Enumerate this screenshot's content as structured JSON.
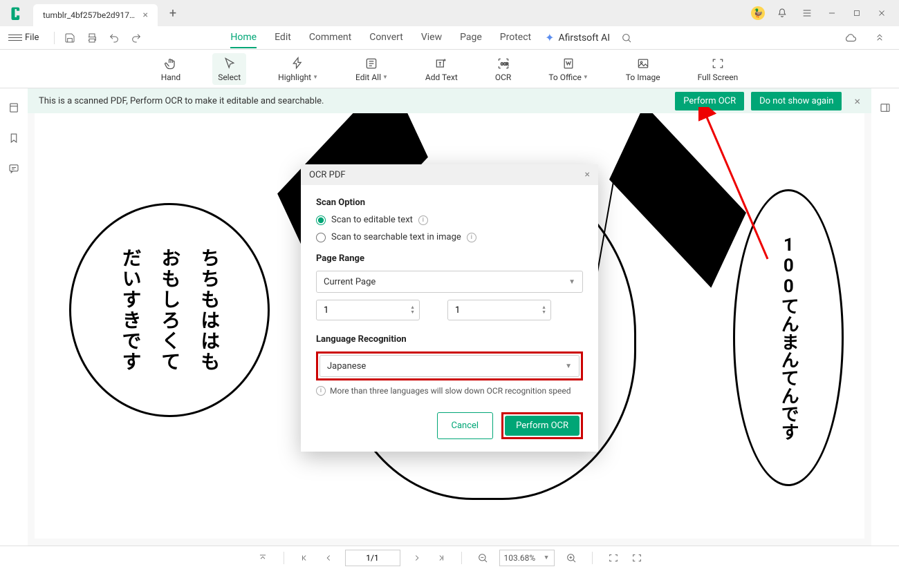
{
  "titlebar": {
    "tab_name": "tumblr_4bf257be2d9173..."
  },
  "menubar": {
    "file": "File",
    "tabs": [
      "Home",
      "Edit",
      "Comment",
      "Convert",
      "View",
      "Page",
      "Protect"
    ],
    "active_tab": "Home",
    "ai_label": "Afirstsoft AI"
  },
  "toolbar": {
    "hand": "Hand",
    "select": "Select",
    "highlight": "Highlight",
    "edit_all": "Edit All",
    "add_text": "Add Text",
    "ocr": "OCR",
    "to_office": "To Office",
    "to_image": "To Image",
    "full_screen": "Full Screen"
  },
  "notice": {
    "text": "This is a scanned PDF, Perform OCR to make it editable and searchable.",
    "perform": "Perform OCR",
    "dismiss": "Do not show again"
  },
  "dialog": {
    "title": "OCR PDF",
    "scan_option_title": "Scan Option",
    "scan_editable": "Scan to editable text",
    "scan_searchable": "Scan to searchable text in image",
    "page_range_title": "Page Range",
    "page_range_value": "Current Page",
    "from_page": "1",
    "to_page": "1",
    "lang_title": "Language Recognition",
    "lang_value": "Japanese",
    "lang_warning": "More than three languages will slow down OCR recognition speed",
    "cancel": "Cancel",
    "perform": "Perform OCR"
  },
  "manga": {
    "bubble_left_col1": "だいすきです",
    "bubble_left_col2": "おもしろくて",
    "bubble_left_col3": "ちちもははも",
    "bubble_right": "100てんまんてんです"
  },
  "statusbar": {
    "page": "1/1",
    "zoom": "103.68%"
  }
}
